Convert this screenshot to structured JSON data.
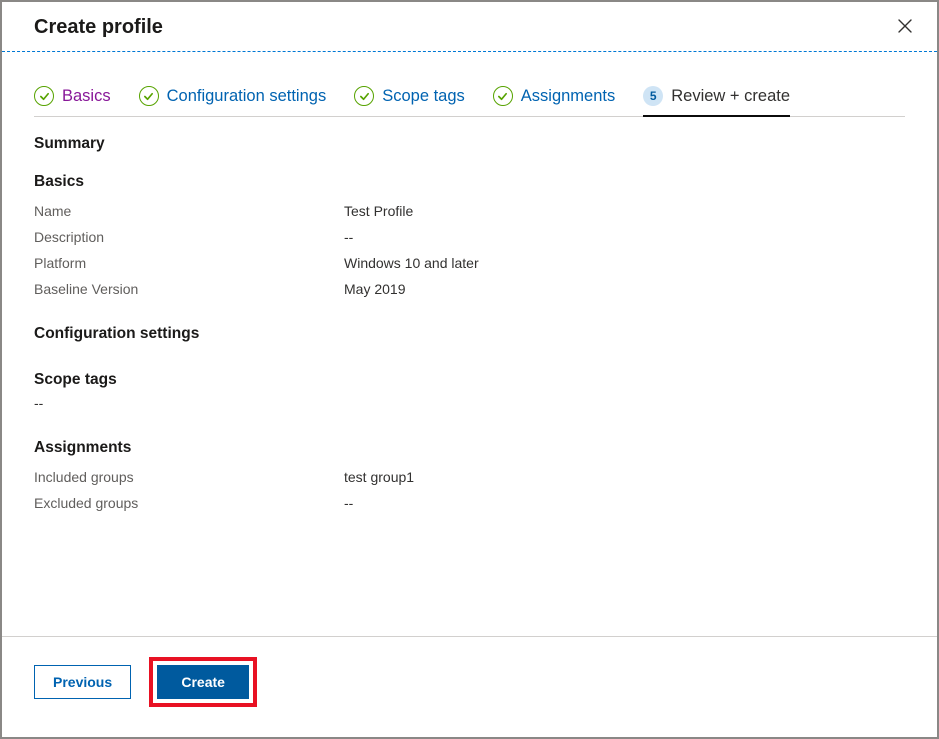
{
  "header": {
    "title": "Create profile"
  },
  "tabs": [
    {
      "label": "Basics",
      "state": "visited"
    },
    {
      "label": "Configuration settings",
      "state": "completed"
    },
    {
      "label": "Scope tags",
      "state": "completed"
    },
    {
      "label": "Assignments",
      "state": "completed"
    },
    {
      "label": "Review + create",
      "state": "current",
      "number": "5"
    }
  ],
  "summary": {
    "heading": "Summary",
    "basics": {
      "heading": "Basics",
      "rows": [
        {
          "key": "Name",
          "val": "Test Profile"
        },
        {
          "key": "Description",
          "val": "--"
        },
        {
          "key": "Platform",
          "val": "Windows 10 and later"
        },
        {
          "key": "Baseline Version",
          "val": "May 2019"
        }
      ]
    },
    "config": {
      "heading": "Configuration settings"
    },
    "scope": {
      "heading": "Scope tags",
      "empty": "--"
    },
    "assignments": {
      "heading": "Assignments",
      "rows": [
        {
          "key": "Included groups",
          "val": "test group1"
        },
        {
          "key": "Excluded groups",
          "val": "--"
        }
      ]
    }
  },
  "footer": {
    "previous": "Previous",
    "create": "Create"
  }
}
